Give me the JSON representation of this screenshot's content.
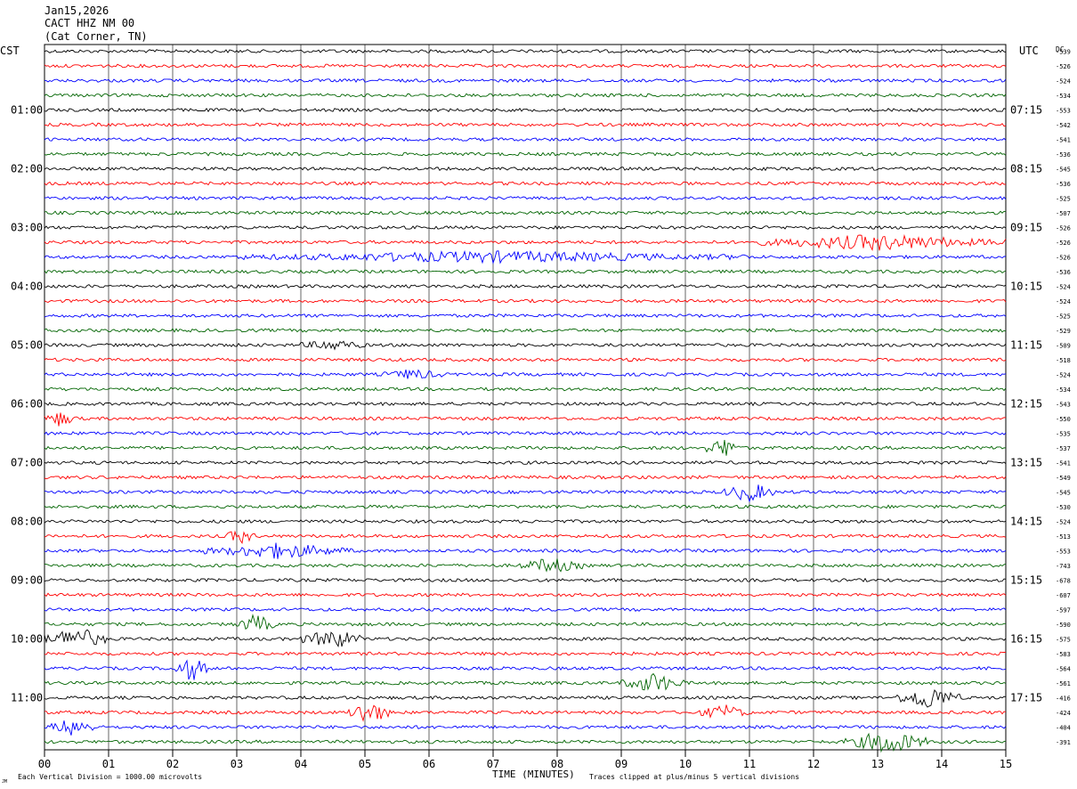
{
  "header": {
    "date": "Jan15,2026",
    "station": "CACT HHZ NM 00",
    "location": "(Cat Corner, TN)"
  },
  "labels": {
    "left_tz": "CST",
    "right_tz": "UTC",
    "dc_label": "DC",
    "xaxis_title": "TIME (MINUTES)",
    "scale_note": "Each Vertical Division = 1000.00 microvolts",
    "clip_note": "Traces clipped at plus/minus 5 vertical divisions",
    "corner_mark": "JM"
  },
  "colors": {
    "traces": [
      "#000000",
      "#ff0000",
      "#0000ff",
      "#006400"
    ],
    "grid": "#000000"
  },
  "chart_data": {
    "type": "line",
    "title": "CACT HHZ NM 00",
    "xlabel": "TIME (MINUTES)",
    "xlim": [
      0,
      15
    ],
    "x_ticks": [
      "00",
      "01",
      "02",
      "03",
      "04",
      "05",
      "06",
      "07",
      "08",
      "09",
      "10",
      "11",
      "12",
      "13",
      "14",
      "15"
    ],
    "rows": 48,
    "row_minutes": 15,
    "left_hour_labels": [
      "01:00",
      "02:00",
      "03:00",
      "04:00",
      "05:00",
      "06:00",
      "07:00",
      "08:00",
      "09:00",
      "10:00",
      "11:00"
    ],
    "right_hour_labels": [
      "07:15",
      "08:15",
      "09:15",
      "10:15",
      "11:15",
      "12:15",
      "13:15",
      "14:15",
      "15:15",
      "16:15",
      "17:15"
    ],
    "dc_offsets": [
      "-539",
      "-526",
      "-524",
      "-534",
      "-553",
      "-542",
      "-541",
      "-536",
      "-545",
      "-536",
      "-525",
      "-507",
      "-526",
      "-526",
      "-526",
      "-536",
      "-524",
      "-524",
      "-525",
      "-529",
      "-509",
      "-518",
      "-524",
      "-534",
      "-543",
      "-550",
      "-535",
      "-537",
      "-541",
      "-549",
      "-545",
      "-530",
      "-524",
      "-513",
      "-553",
      "-743",
      "-678",
      "-607",
      "-597",
      "-590",
      "-575",
      "-583",
      "-564",
      "-561",
      "-416",
      "-424",
      "-404",
      "-391"
    ],
    "events": [
      {
        "row": 13,
        "start_min": 11.0,
        "end_min": 15.0,
        "amp": 3
      },
      {
        "row": 14,
        "start_min": 3.0,
        "end_min": 11.0,
        "amp": 2
      },
      {
        "row": 20,
        "start_min": 4.0,
        "end_min": 5.0,
        "amp": 2
      },
      {
        "row": 22,
        "start_min": 5.3,
        "end_min": 6.2,
        "amp": 2
      },
      {
        "row": 25,
        "start_min": 0.0,
        "end_min": 0.5,
        "amp": 3
      },
      {
        "row": 27,
        "start_min": 10.3,
        "end_min": 10.9,
        "amp": 4
      },
      {
        "row": 30,
        "start_min": 10.6,
        "end_min": 11.4,
        "amp": 4
      },
      {
        "row": 33,
        "start_min": 2.8,
        "end_min": 3.3,
        "amp": 3
      },
      {
        "row": 34,
        "start_min": 2.5,
        "end_min": 4.8,
        "amp": 3
      },
      {
        "row": 35,
        "start_min": 7.4,
        "end_min": 8.4,
        "amp": 3
      },
      {
        "row": 39,
        "start_min": 3.0,
        "end_min": 3.6,
        "amp": 4
      },
      {
        "row": 40,
        "start_min": 0.0,
        "end_min": 1.0,
        "amp": 5
      },
      {
        "row": 40,
        "start_min": 4.0,
        "end_min": 5.0,
        "amp": 4
      },
      {
        "row": 42,
        "start_min": 2.0,
        "end_min": 2.6,
        "amp": 5
      },
      {
        "row": 43,
        "start_min": 9.0,
        "end_min": 10.0,
        "amp": 4
      },
      {
        "row": 44,
        "start_min": 13.3,
        "end_min": 14.3,
        "amp": 5
      },
      {
        "row": 45,
        "start_min": 4.7,
        "end_min": 5.4,
        "amp": 5
      },
      {
        "row": 45,
        "start_min": 10.2,
        "end_min": 11.0,
        "amp": 3
      },
      {
        "row": 46,
        "start_min": 0.1,
        "end_min": 0.8,
        "amp": 4
      },
      {
        "row": 47,
        "start_min": 12.5,
        "end_min": 13.8,
        "amp": 5
      }
    ]
  }
}
